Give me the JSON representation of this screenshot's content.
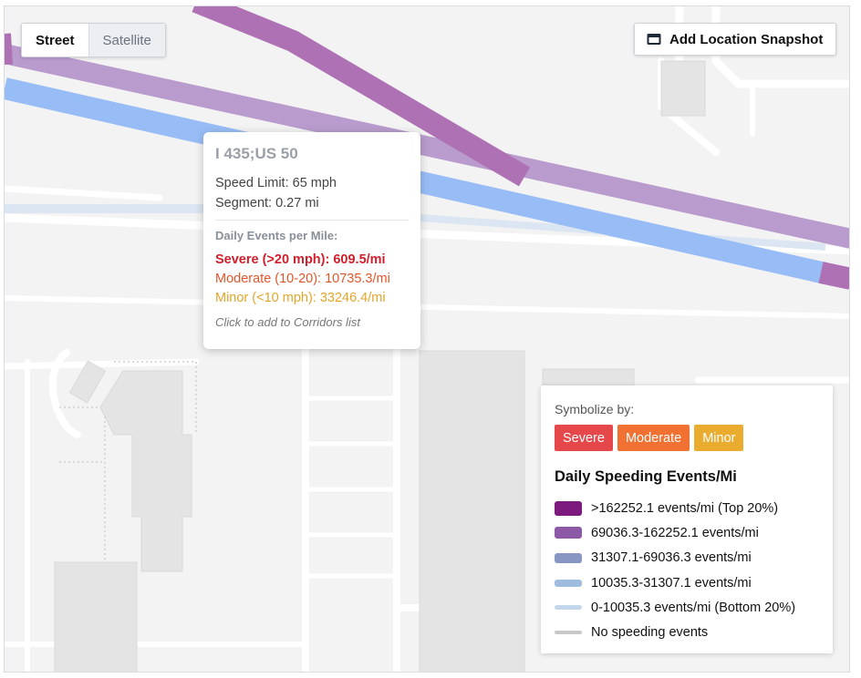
{
  "view_toggle": {
    "street": "Street",
    "satellite": "Satellite",
    "selected": "Street"
  },
  "snapshot_button": {
    "label": "Add Location Snapshot",
    "icon": "image-icon"
  },
  "popup": {
    "title": "I 435;US 50",
    "speed_limit": "Speed Limit: 65 mph",
    "segment": "Segment: 0.27 mi",
    "subtitle": "Daily Events per Mile:",
    "severe": "Severe (>20 mph): 609.5/mi",
    "moderate": "Moderate (10-20): 10735.3/mi",
    "minor": "Minor (<10 mph): 33246.4/mi",
    "hint": "Click to add to Corridors list"
  },
  "legend": {
    "symbolize_label": "Symbolize by:",
    "buttons": [
      {
        "label": "Severe",
        "color": "#e5474b"
      },
      {
        "label": "Moderate",
        "color": "#f07132"
      },
      {
        "label": "Minor",
        "color": "#e9ac2f"
      }
    ],
    "heading": "Daily Speeding Events/Mi",
    "classes": [
      {
        "label": ">162252.1 events/mi (Top 20%)",
        "color": "#7d1a7e"
      },
      {
        "label": "69036.3-162252.1 events/mi",
        "color": "#8c59a6"
      },
      {
        "label": "31307.1-69036.3 events/mi",
        "color": "#8796c3"
      },
      {
        "label": "10035.3-31307.1 events/mi",
        "color": "#9ebcde"
      },
      {
        "label": "0-10035.3 events/mi (Bottom 20%)",
        "color": "#c3d7ea"
      },
      {
        "label": "No speeding events",
        "color": "#c8c8c8"
      }
    ]
  },
  "colors": {
    "road_blue": "#98bdf6",
    "road_lavender": "#b99ccd",
    "road_magenta": "#ad71b4",
    "road_light": "#dbe6f2",
    "map_bg": "#f3f3f3"
  }
}
